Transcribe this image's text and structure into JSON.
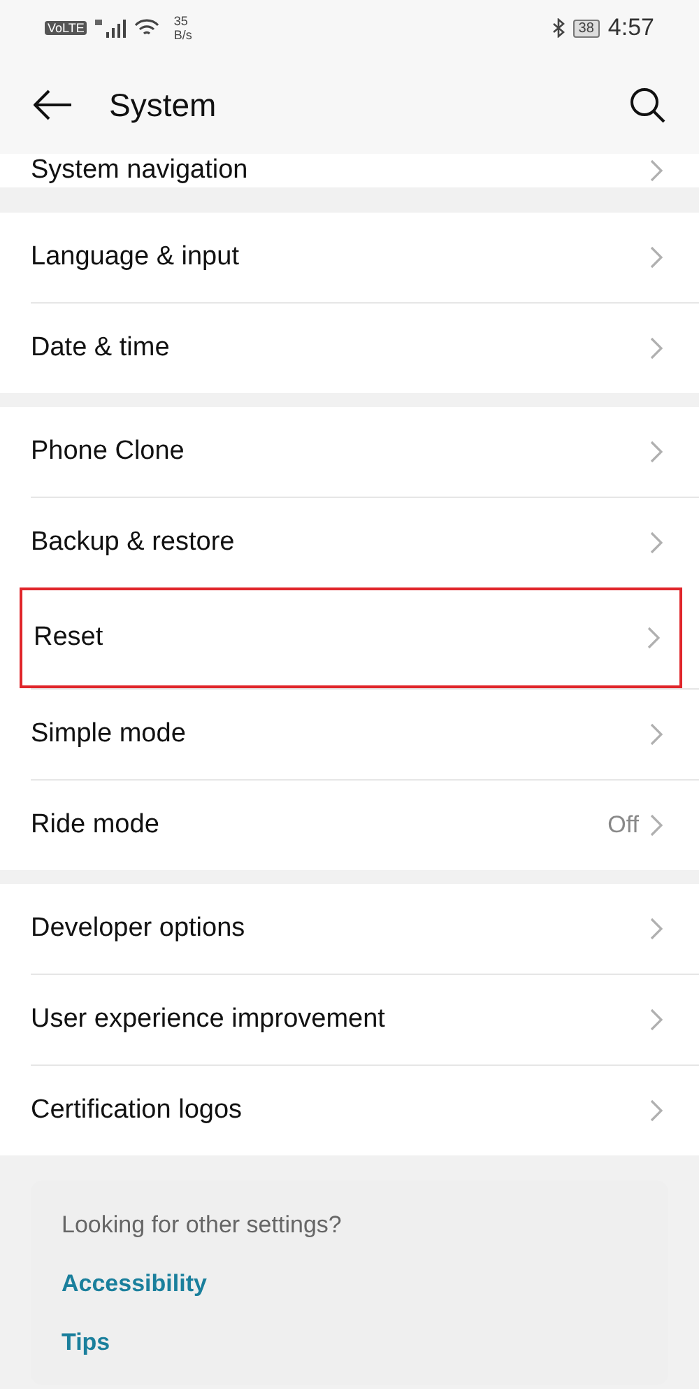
{
  "status_bar": {
    "volte_label": "VoLTE",
    "network_speed": "35",
    "network_speed_unit": "B/s",
    "battery": "38",
    "time": "4:57"
  },
  "header": {
    "title": "System"
  },
  "partial_item": {
    "label": "System navigation"
  },
  "groups": [
    {
      "items": [
        {
          "label": "Language & input",
          "highlighted": false
        },
        {
          "label": "Date & time",
          "highlighted": false
        }
      ]
    },
    {
      "items": [
        {
          "label": "Phone Clone",
          "highlighted": false
        },
        {
          "label": "Backup & restore",
          "highlighted": false
        },
        {
          "label": "Reset",
          "highlighted": true
        },
        {
          "label": "Simple mode",
          "highlighted": false
        },
        {
          "label": "Ride mode",
          "value": "Off",
          "highlighted": false
        }
      ]
    },
    {
      "items": [
        {
          "label": "Developer options",
          "highlighted": false
        },
        {
          "label": "User experience improvement",
          "highlighted": false
        },
        {
          "label": "Certification logos",
          "highlighted": false
        }
      ]
    }
  ],
  "suggestions": {
    "title": "Looking for other settings?",
    "links": [
      "Accessibility",
      "Tips"
    ]
  }
}
